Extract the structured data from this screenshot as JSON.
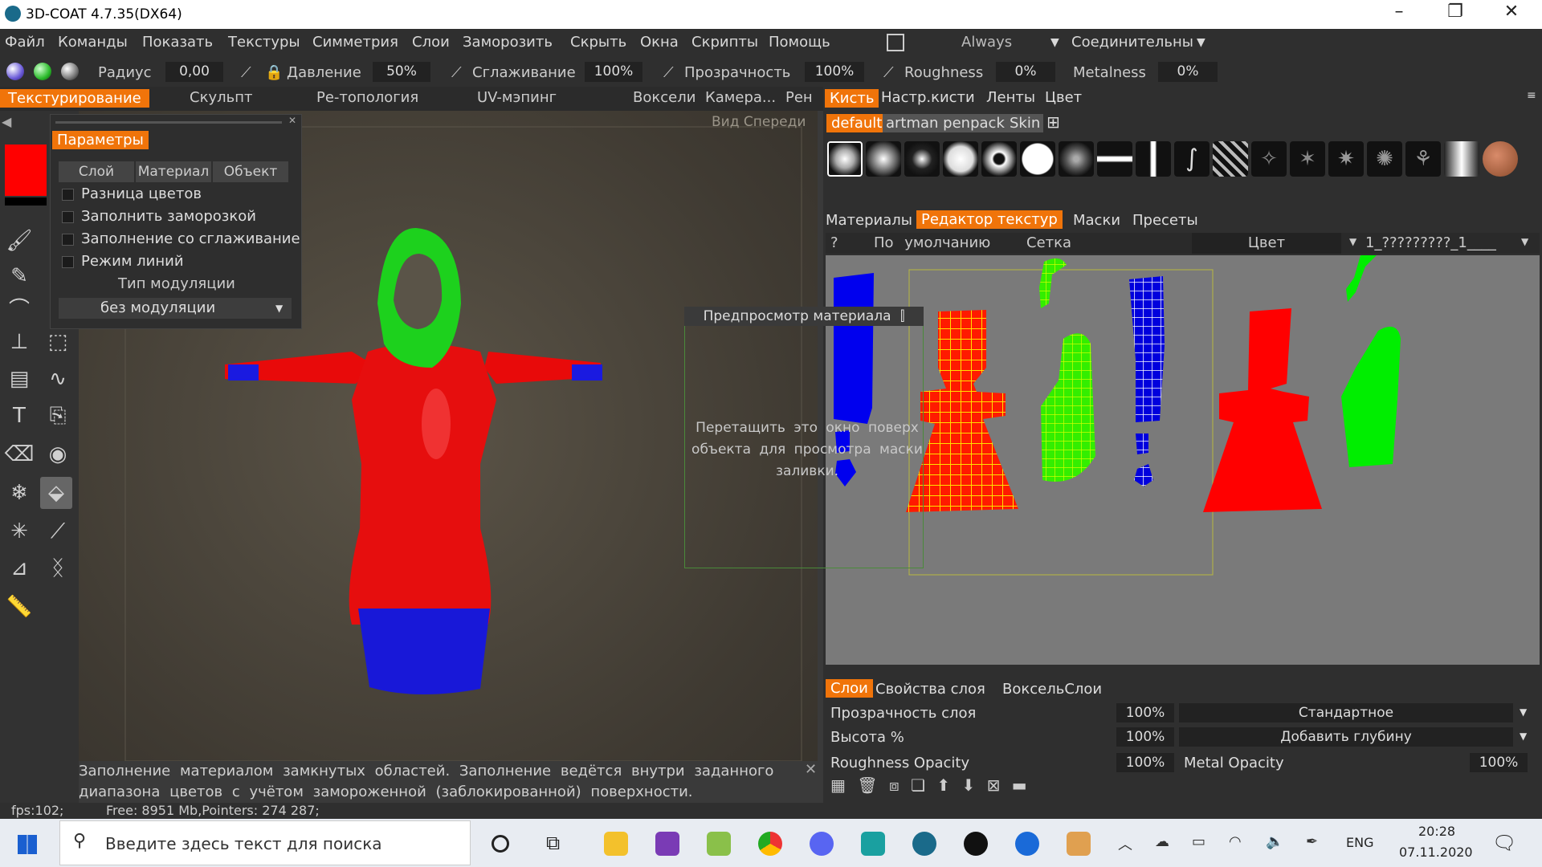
{
  "window": {
    "title": "3D-COAT 4.7.35(DX64)"
  },
  "menu": [
    "Файл",
    "Команды",
    "Показать",
    "Текстуры",
    "Симметрия",
    "Слои",
    "Заморозить",
    "Скрыть",
    "Окна",
    "Скрипты",
    "Помощь"
  ],
  "menu_right": {
    "always": "Always",
    "connect": "Соединительны"
  },
  "toolbar": {
    "radius_label": "Радиус",
    "radius_val": "0,00",
    "pressure_label": "Давление",
    "pressure_val": "50%",
    "smooth_label": "Сглаживание",
    "smooth_val": "100%",
    "opacity_label": "Прозрачность",
    "opacity_val": "100%",
    "rough_label": "Roughness",
    "rough_val": "0%",
    "metal_label": "Metalness",
    "metal_val": "0%"
  },
  "rooms": [
    "Текстурирование",
    "Скульпт",
    "Ре-топология",
    "UV-мэпинг",
    "Воксели",
    "Камера...",
    "Рен"
  ],
  "viewport": {
    "view_label": "Вид Спереди"
  },
  "params": {
    "title": "Параметры",
    "tabs": [
      "Слой",
      "Материал",
      "Объект"
    ],
    "options": [
      "Разница цветов",
      "Заполнить заморозкой",
      "Заполнение со сглаживание",
      "Режим линий"
    ],
    "mod_type_label": "Тип модуляции",
    "mod_value": "без модуляции"
  },
  "preview": {
    "title": "Предпросмотр материала",
    "hint": "Перетащить это окно поверх объекта для просмотра маски заливки."
  },
  "status": {
    "line1": "Заполнение материалом замкнутых областей. Заполнение ведётся внутри заданного",
    "line2": "диапазона цветов с учётом замороженной (заблокированной) поверхности.",
    "fps": "fps:102;",
    "mem": "Free: 8951 Mb,Pointers: 274 287;"
  },
  "right": {
    "brush_tabs": [
      "Кисть",
      "Настр.кисти",
      "Ленты",
      "Цвет"
    ],
    "brush_sets": [
      "default",
      "artman penpack",
      "Skin"
    ],
    "editor_tabs": [
      "Материалы",
      "Редактор текстур",
      "Маски",
      "Пресеты"
    ],
    "editor_bar": {
      "q": "?",
      "default": "По умолчанию",
      "grid": "Сетка",
      "color": "Цвет",
      "texname": "1_?????????_1____"
    },
    "layer_tabs": [
      "Слои",
      "Свойства слоя",
      "ВоксельСлои"
    ],
    "layer_opacity_label": "Прозрачность слоя",
    "layer_opacity_val": "100%",
    "blend_mode": "Стандартное",
    "height_label": "Высота %",
    "height_val": "100%",
    "depth_mode": "Добавить глубину",
    "rough_op_label": "Roughness Opacity",
    "rough_op_val": "100%",
    "metal_op_label": "Metal Opacity",
    "metal_op_val": "100%"
  },
  "taskbar": {
    "search_placeholder": "Введите здесь текст для поиска",
    "lang": "ENG",
    "time": "20:28",
    "date": "07.11.2020"
  },
  "colors": {
    "accent": "#f0740a",
    "red": "#ff0000",
    "green": "#22ee22",
    "blue": "#1a1ae0"
  }
}
